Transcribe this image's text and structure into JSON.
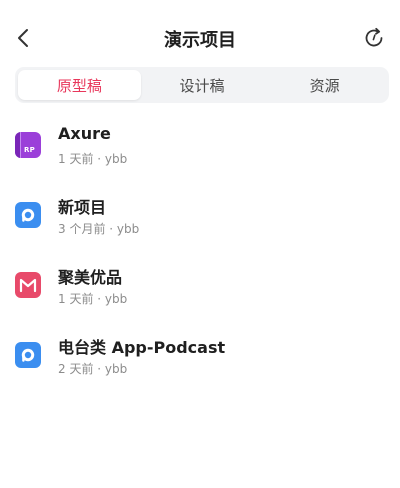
{
  "header": {
    "title": "演示项目",
    "back_icon": "chevron-left-icon",
    "refresh_icon": "refresh-icon"
  },
  "tabs": [
    {
      "label": "原型稿",
      "active": true
    },
    {
      "label": "设计稿",
      "active": false
    },
    {
      "label": "资源",
      "active": false
    }
  ],
  "projects": [
    {
      "name": "Axure",
      "meta": "1 天前 · ybb",
      "icon": "axure-rp-icon",
      "icon_color": "#9b3fd9",
      "icon_text": "RP"
    },
    {
      "name": "新项目",
      "meta": "3 个月前 · ybb",
      "icon": "app-prototype-icon",
      "icon_color": "#3b8ef0"
    },
    {
      "name": "聚美优品",
      "meta": "1 天前 · ybb",
      "icon": "jumei-logo-icon",
      "icon_color": "#e84a6a"
    },
    {
      "name": "电台类 App-Podcast",
      "meta": "2 天前 · ybb",
      "icon": "app-prototype-icon",
      "icon_color": "#3b8ef0"
    }
  ],
  "colors": {
    "accent": "#e8375b",
    "tab_bg": "#f2f3f5",
    "meta_text": "#8c8c8c"
  }
}
